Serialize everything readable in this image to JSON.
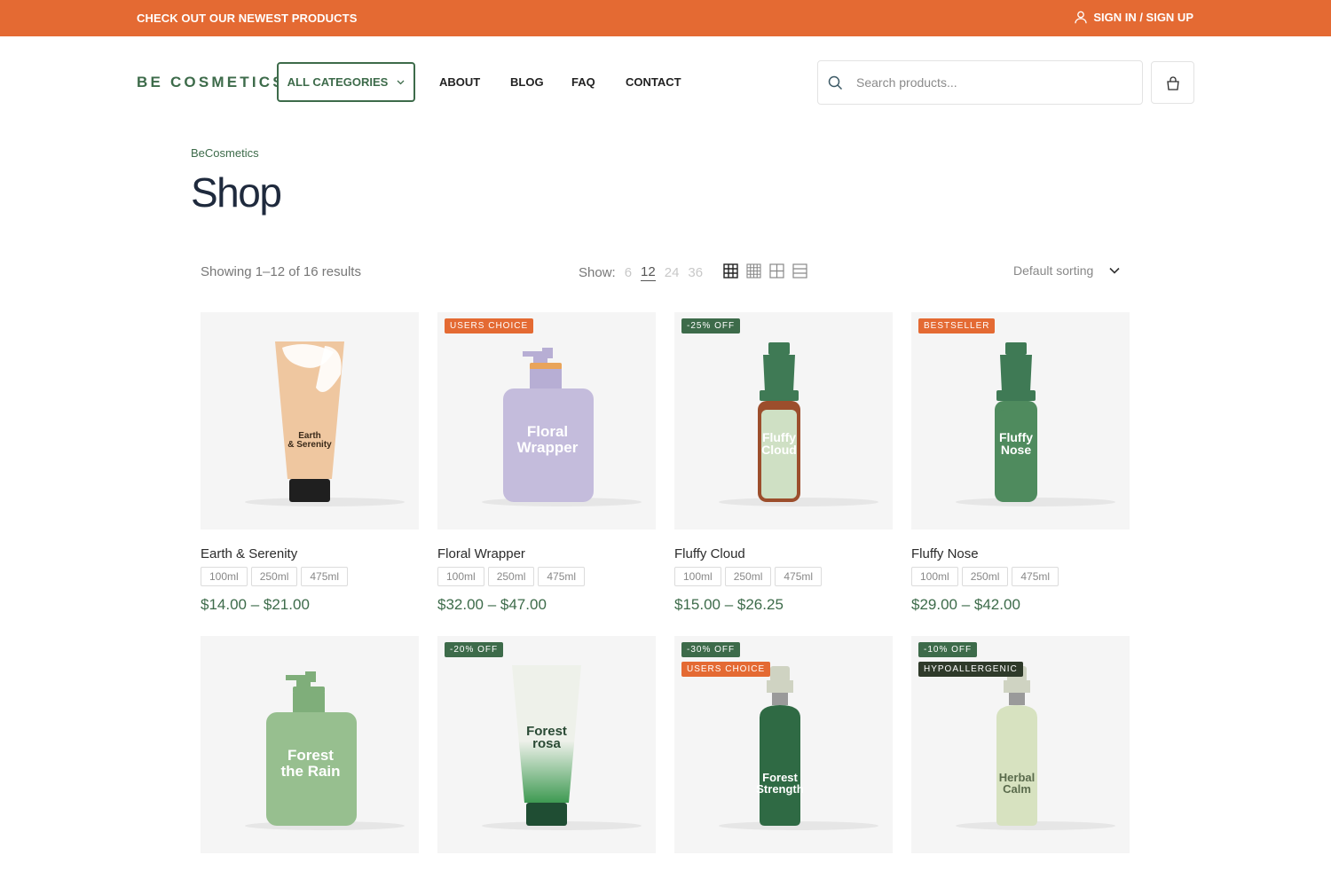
{
  "topbar": {
    "promo": "CHECK OUT OUR NEWEST PRODUCTS",
    "signin": "SIGN IN / SIGN UP",
    "bg_color": "#e46a33"
  },
  "header": {
    "logo": "BE COSMETICS",
    "categories_label": "ALL CATEGORIES",
    "nav": [
      "ABOUT",
      "BLOG",
      "FAQ",
      "CONTACT"
    ],
    "search_placeholder": "Search products...",
    "accent_color": "#3d6b4a"
  },
  "breadcrumb": "BeCosmetics",
  "page_title": "Shop",
  "toolbar": {
    "results": "Showing 1–12 of 16 results",
    "show_label": "Show:",
    "show_options": [
      "6",
      "12",
      "24",
      "36"
    ],
    "show_selected": "12",
    "view_icons": [
      "grid-4-icon",
      "grid-5-icon",
      "grid-3-icon",
      "list-icon"
    ],
    "sort_label": "Default sorting"
  },
  "products": [
    {
      "name": "Earth & Serenity",
      "sizes": [
        "100ml",
        "250ml",
        "475ml"
      ],
      "price": "$14.00 – $21.00",
      "badges": [],
      "label": [
        "Earth",
        "& Serenity"
      ]
    },
    {
      "name": "Floral Wrapper",
      "sizes": [
        "100ml",
        "250ml",
        "475ml"
      ],
      "price": "$32.00 – $47.00",
      "badges": [
        {
          "text": "USERS CHOICE",
          "color": "#e46a33"
        }
      ],
      "label": [
        "Floral",
        "Wrapper"
      ]
    },
    {
      "name": "Fluffy Cloud",
      "sizes": [
        "100ml",
        "250ml",
        "475ml"
      ],
      "price": "$15.00 – $26.25",
      "badges": [
        {
          "text": "-25% OFF",
          "color": "#3d6b4a"
        }
      ],
      "label": [
        "Fluffy",
        "Cloud"
      ]
    },
    {
      "name": "Fluffy Nose",
      "sizes": [
        "100ml",
        "250ml",
        "475ml"
      ],
      "price": "$29.00 – $42.00",
      "badges": [
        {
          "text": "BESTSELLER",
          "color": "#e46a33"
        }
      ],
      "label": [
        "Fluffy",
        "Nose"
      ]
    },
    {
      "name": "",
      "sizes": [],
      "price": "",
      "badges": [],
      "label": [
        "Forest",
        "the Rain"
      ]
    },
    {
      "name": "",
      "sizes": [],
      "price": "",
      "badges": [
        {
          "text": "-20% OFF",
          "color": "#3d6b4a"
        }
      ],
      "label": [
        "Forest",
        "rosa"
      ]
    },
    {
      "name": "",
      "sizes": [],
      "price": "",
      "badges": [
        {
          "text": "-30% OFF",
          "color": "#3d6b4a"
        },
        {
          "text": "USERS CHOICE",
          "color": "#e46a33"
        }
      ],
      "label": [
        "Forest",
        "Strength"
      ]
    },
    {
      "name": "",
      "sizes": [],
      "price": "",
      "badges": [
        {
          "text": "-10% OFF",
          "color": "#3d6b4a"
        },
        {
          "text": "HYPOALLERGENIC",
          "color": "#2f3a2a"
        }
      ],
      "label": [
        "Herbal",
        "Calm"
      ]
    }
  ]
}
